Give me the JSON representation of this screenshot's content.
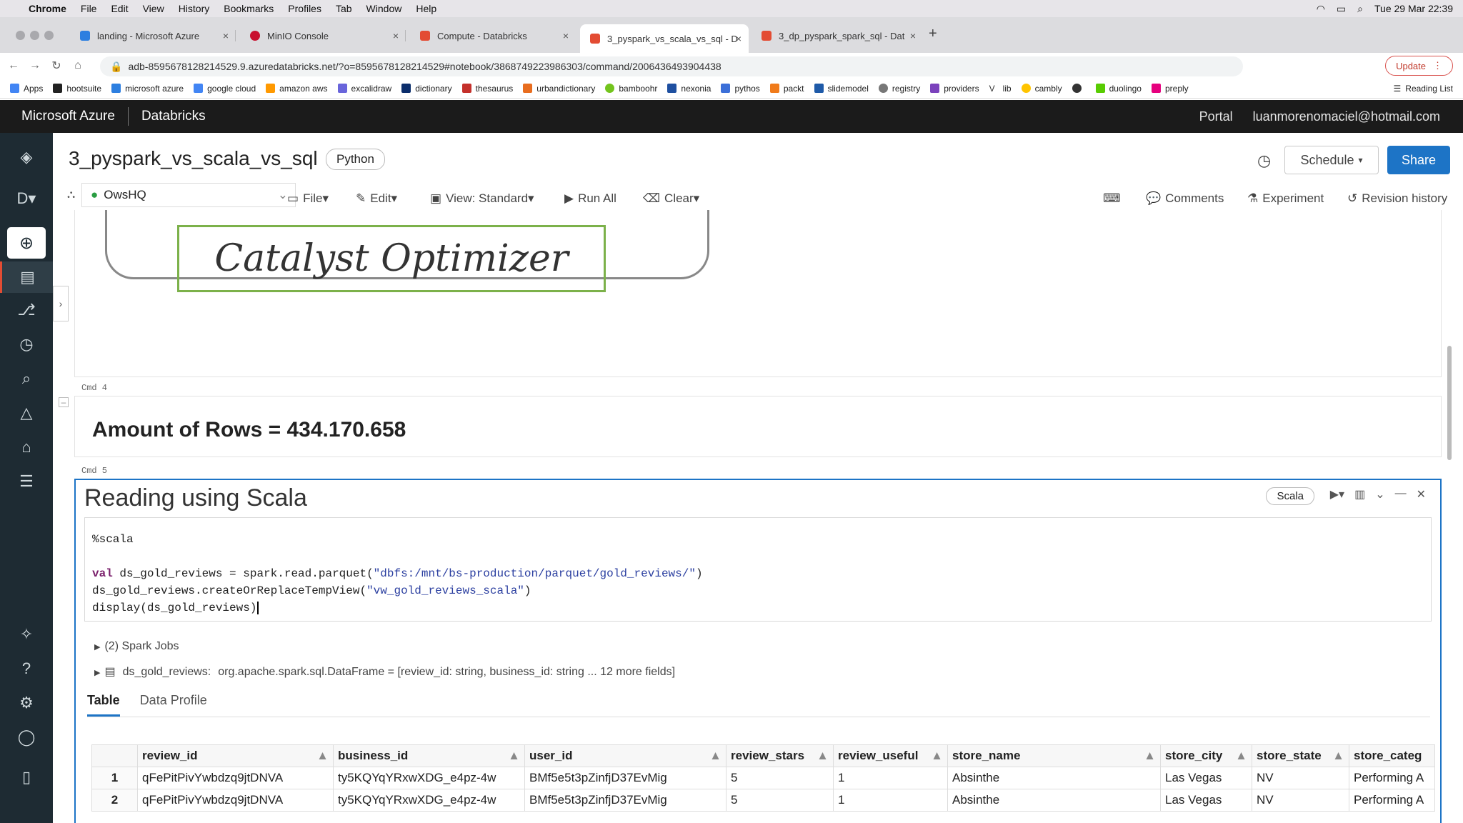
{
  "os_menubar": {
    "app": "Chrome",
    "items": [
      "File",
      "Edit",
      "View",
      "History",
      "Bookmarks",
      "Profiles",
      "Tab",
      "Window",
      "Help"
    ],
    "datetime": "Tue 29 Mar  22:39"
  },
  "browser": {
    "tabs": [
      {
        "title": "landing - Microsoft Azure",
        "color": "#2d7fe0"
      },
      {
        "title": "MinIO Console",
        "color": "#c8102e"
      },
      {
        "title": "Compute - Databricks",
        "color": "#e34c33"
      },
      {
        "title": "3_pyspark_vs_scala_vs_sql - D",
        "color": "#e34c33"
      },
      {
        "title": "3_dp_pyspark_spark_sql - Dat",
        "color": "#e34c33"
      }
    ],
    "url": "adb-8595678128214529.9.azuredatabricks.net/?o=8595678128214529#notebook/3868749223986303/command/2006436493904438",
    "update_label": "Update",
    "bookmarks": [
      "Apps",
      "hootsuite",
      "microsoft azure",
      "google cloud",
      "amazon aws",
      "excalidraw",
      "dictionary",
      "thesaurus",
      "urbandictionary",
      "bamboohr",
      "nexonia",
      "pythos",
      "packt",
      "slidemodel",
      "registry",
      "providers",
      "lib",
      "cambly",
      "",
      "duolingo",
      "preply"
    ],
    "reading_list": "Reading List"
  },
  "azure_header": {
    "brand": "Microsoft Azure",
    "product": "Databricks",
    "portal": "Portal",
    "user": "luanmorenomaciel@hotmail.com"
  },
  "notebook": {
    "title": "3_pyspark_vs_scala_vs_sql",
    "language": "Python",
    "schedule_label": "Schedule",
    "share_label": "Share",
    "cluster": "OwsHQ",
    "menu": {
      "file": "File",
      "edit": "Edit",
      "view": "View: Standard",
      "run_all": "Run All",
      "clear": "Clear"
    },
    "right_menu": {
      "comments": "Comments",
      "experiment": "Experiment",
      "revision": "Revision history"
    }
  },
  "cells": {
    "image_text": "Catalyst Optimizer",
    "cmd4": "Cmd 4",
    "rows_heading": "Amount of Rows = 434.170.658",
    "cmd5": "Cmd 5",
    "scala_title": "Reading using Scala",
    "scala_lang": "Scala",
    "code_line1": "%scala",
    "code_val": "val",
    "code_line3a": " ds_gold_reviews = spark.read.parquet(",
    "code_line3b": "\"dbfs:/mnt/bs-production/parquet/gold_reviews/\"",
    "code_line3c": ")",
    "code_line4a": "ds_gold_reviews.createOrReplaceTempView(",
    "code_line4b": "\"vw_gold_reviews_scala\"",
    "code_line4c": ")",
    "code_line5": "display(ds_gold_reviews)",
    "spark_jobs": "(2) Spark Jobs",
    "df_name": "ds_gold_reviews:",
    "df_schema": "org.apache.spark.sql.DataFrame = [review_id: string, business_id: string ... 12 more fields]",
    "tab_table": "Table",
    "tab_profile": "Data Profile"
  },
  "table": {
    "headers": [
      "review_id",
      "business_id",
      "user_id",
      "review_stars",
      "review_useful",
      "store_name",
      "store_city",
      "store_state",
      "store_categ"
    ],
    "rows": [
      [
        "1",
        "qFePitPivYwbdzq9jtDNVA",
        "ty5KQYqYRxwXDG_e4pz-4w",
        "BMf5e5t3pZinfjD37EvMig",
        "5",
        "1",
        "Absinthe",
        "Las Vegas",
        "NV",
        "Performing A"
      ],
      [
        "2",
        "qFePitPivYwbdzq9jtDNVA",
        "ty5KQYqYRxwXDG_e4pz-4w",
        "BMf5e5t3pZinfjD37EvMig",
        "5",
        "1",
        "Absinthe",
        "Las Vegas",
        "NV",
        "Performing A"
      ]
    ]
  }
}
